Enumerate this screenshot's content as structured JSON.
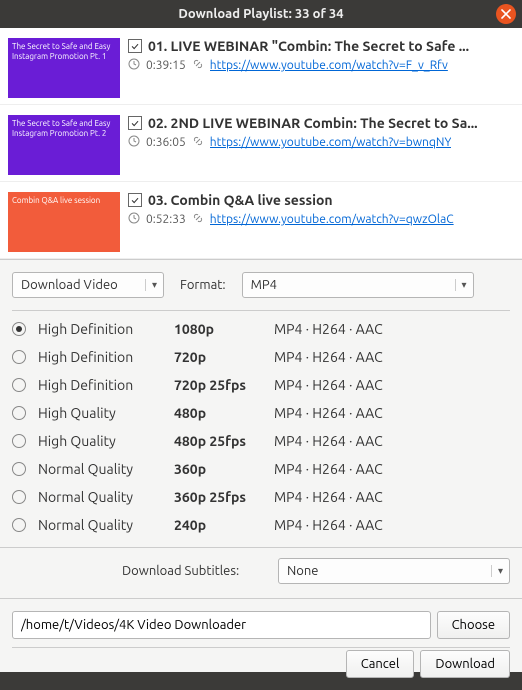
{
  "window": {
    "title": "Download Playlist: 33 of 34"
  },
  "playlist": [
    {
      "thumb_class": "thumb1",
      "thumb_text": "The Secret to Safe and Easy Instagram Promotion Pt. 1",
      "title": "01. LIVE WEBINAR \"Combin: The Secret to Safe ...",
      "duration": "0:39:15",
      "url": "https://www.youtube.com/watch?v=F_v_Rfv"
    },
    {
      "thumb_class": "thumb2",
      "thumb_text": "The Secret to Safe and Easy Instagram Promotion Pt. 2",
      "title": "02. 2ND LIVE WEBINAR Combin: The Secret to Sa...",
      "duration": "0:36:05",
      "url": "https://www.youtube.com/watch?v=bwnqNY"
    },
    {
      "thumb_class": "thumb3",
      "thumb_text": "Combin Q&A live session",
      "title": "03. Combin Q&A live session",
      "duration": "0:52:33",
      "url": "https://www.youtube.com/watch?v=qwzOlaC"
    }
  ],
  "action_dropdown": "Download Video",
  "format_label": "Format:",
  "format_value": "MP4",
  "qualities": [
    {
      "label": "High Definition",
      "res": "1080p",
      "codec": "MP4 · H264 · AAC",
      "selected": true
    },
    {
      "label": "High Definition",
      "res": "720p",
      "codec": "MP4 · H264 · AAC",
      "selected": false
    },
    {
      "label": "High Definition",
      "res": "720p 25fps",
      "codec": "MP4 · H264 · AAC",
      "selected": false
    },
    {
      "label": "High Quality",
      "res": "480p",
      "codec": "MP4 · H264 · AAC",
      "selected": false
    },
    {
      "label": "High Quality",
      "res": "480p 25fps",
      "codec": "MP4 · H264 · AAC",
      "selected": false
    },
    {
      "label": "Normal Quality",
      "res": "360p",
      "codec": "MP4 · H264 · AAC",
      "selected": false
    },
    {
      "label": "Normal Quality",
      "res": "360p 25fps",
      "codec": "MP4 · H264 · AAC",
      "selected": false
    },
    {
      "label": "Normal Quality",
      "res": "240p",
      "codec": "MP4 · H264 · AAC",
      "selected": false
    }
  ],
  "subtitles_label": "Download Subtitles:",
  "subtitles_value": "None",
  "path": "/home/t/Videos/4K Video Downloader",
  "buttons": {
    "choose": "Choose",
    "cancel": "Cancel",
    "download": "Download"
  }
}
